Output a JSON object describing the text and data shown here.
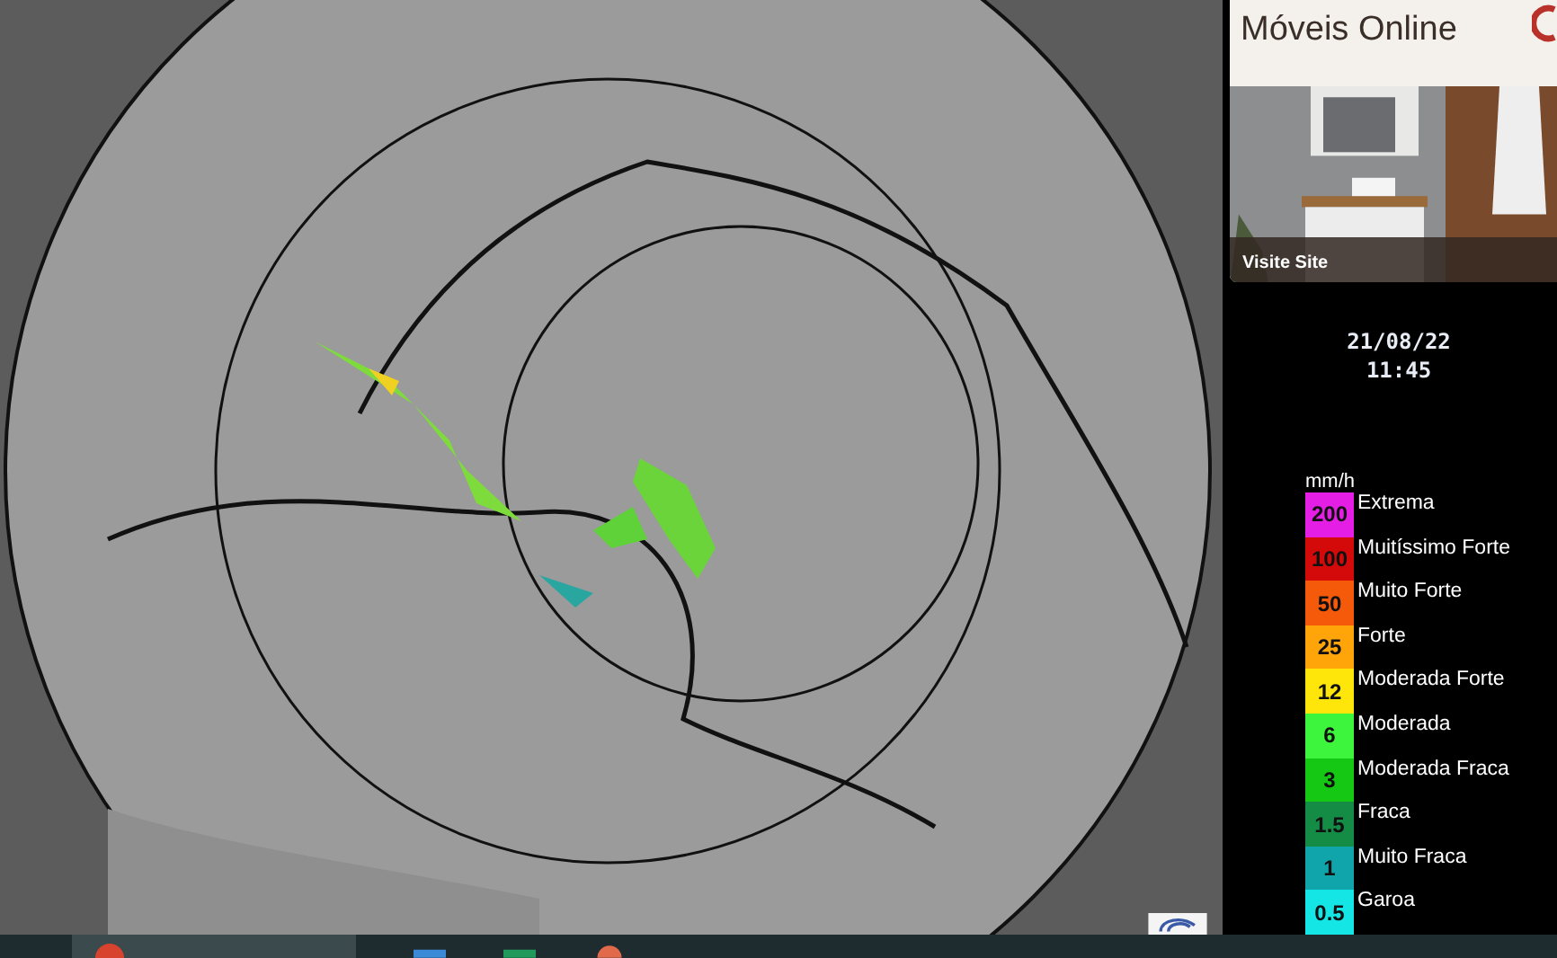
{
  "ad": {
    "heading": "Móveis Online",
    "cta": "Visite Site"
  },
  "timestamp": {
    "date": "21/08/22",
    "time": "11:45"
  },
  "legend": {
    "unit": "mm/h",
    "bands": [
      {
        "value": "200",
        "label": "Extrema",
        "color": "#e41ee4"
      },
      {
        "value": "100",
        "label": "Muitíssimo Forte",
        "color": "#d40a0a"
      },
      {
        "value": "50",
        "label": "Muito Forte",
        "color": "#f55a0a"
      },
      {
        "value": "25",
        "label": "Forte",
        "color": "#ffa50a"
      },
      {
        "value": "12",
        "label": "Moderada Forte",
        "color": "#ffe60a"
      },
      {
        "value": "6",
        "label": "Moderada",
        "color": "#3cf53c"
      },
      {
        "value": "3",
        "label": "Moderada Fraca",
        "color": "#14c814"
      },
      {
        "value": "1.5",
        "label": "Fraca",
        "color": "#148c46"
      },
      {
        "value": "1",
        "label": "Muito Fraca",
        "color": "#0fa5aa"
      },
      {
        "value": "0.5",
        "label": "Garoa",
        "color": "#14e6e6"
      }
    ]
  }
}
